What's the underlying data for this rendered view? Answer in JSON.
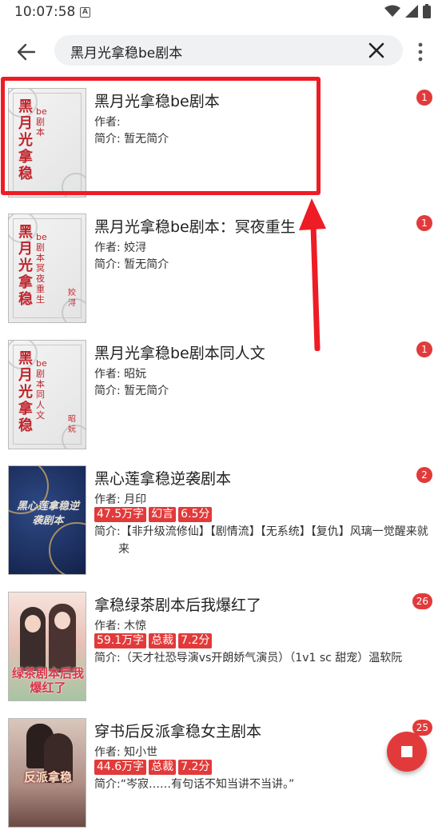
{
  "status": {
    "time": "10:07:58",
    "notif_letter": "A"
  },
  "search": {
    "query": "黑月光拿稳be剧本"
  },
  "books": [
    {
      "title": "黑月光拿稳be剧本",
      "author_label": "作者:",
      "author": "",
      "intro_label": "简介:",
      "intro": "暂无简介",
      "badge": "1",
      "cover": {
        "style": "plain",
        "big": "黑月光拿稳",
        "small": "be剧本",
        "author": ""
      }
    },
    {
      "title": "黑月光拿稳be剧本：冥夜重生",
      "author_label": "作者:",
      "author": "姣浔",
      "intro_label": "简介:",
      "intro": "暂无简介",
      "badge": "1",
      "cover": {
        "style": "plain",
        "big": "黑月光拿稳",
        "small": "be剧本冥夜重生",
        "author": "姣浔"
      }
    },
    {
      "title": "黑月光拿稳be剧本同人文",
      "author_label": "作者:",
      "author": "昭妧",
      "intro_label": "简介:",
      "intro": "暂无简介",
      "badge": "1",
      "cover": {
        "style": "plain",
        "big": "黑月光拿稳",
        "small": "be剧本同人文",
        "author": "昭妧"
      }
    },
    {
      "title": "黑心莲拿稳逆袭剧本",
      "author_label": "作者:",
      "author": "月印",
      "intro_label": "简介:",
      "intro": "【非升级流修仙】【剧情流】【无系统】【复仇】风璃一觉醒来就来",
      "badge": "2",
      "tags": [
        "47.5万字",
        "幻言",
        "6.5分"
      ],
      "cover": {
        "style": "dark",
        "text": "黑心莲拿稳逆袭剧本"
      }
    },
    {
      "title": "拿稳绿茶剧本后我爆红了",
      "author_label": "作者:",
      "author": "木惊",
      "intro_label": "简介:",
      "intro": "（天才社恐导演vs开朗娇气演员）（1v1 sc 甜宠）温软阮",
      "badge": "26",
      "tags": [
        "59.1万字",
        "总裁",
        "7.2分"
      ],
      "cover": {
        "style": "pink",
        "text": "绿茶剧本后我爆红了"
      }
    },
    {
      "title": "穿书后反派拿稳女主剧本",
      "author_label": "作者:",
      "author": "知小世",
      "intro_label": "简介:",
      "intro": "“岑寂……有句话不知当讲不当讲。”",
      "badge": "25",
      "tags": [
        "44.6万字",
        "总裁",
        "7.2分"
      ],
      "cover": {
        "style": "couple",
        "text": "反派拿稳"
      }
    }
  ]
}
